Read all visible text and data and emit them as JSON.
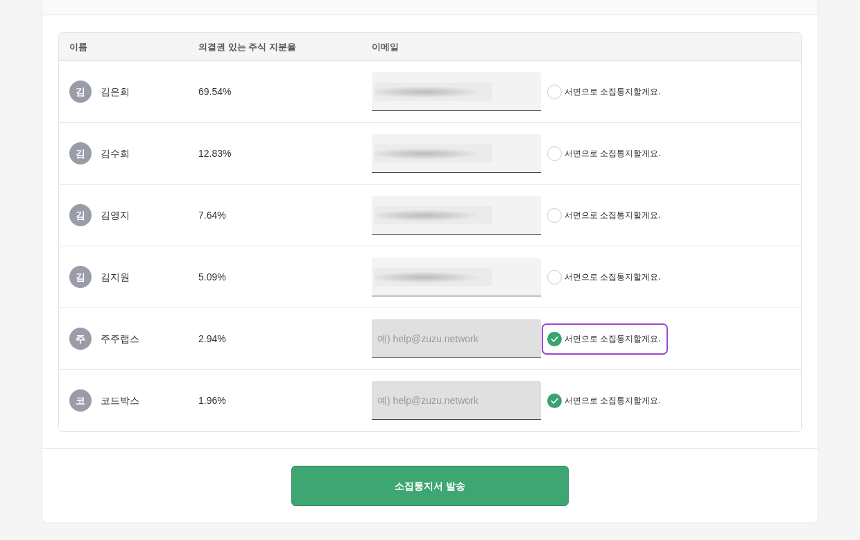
{
  "table": {
    "columns": [
      "이름",
      "의결권 있는 주식 지분율",
      "이메일"
    ],
    "rows": [
      {
        "initial": "김",
        "name": "김은희",
        "share": "69.54%",
        "email": {
          "blurred": true,
          "disabled": false
        },
        "notice": {
          "label": "서면으로 소집통지할게요.",
          "checked": false,
          "focused": false
        }
      },
      {
        "initial": "김",
        "name": "김수희",
        "share": "12.83%",
        "email": {
          "blurred": true,
          "disabled": false
        },
        "notice": {
          "label": "서면으로 소집통지할게요.",
          "checked": false,
          "focused": false
        }
      },
      {
        "initial": "김",
        "name": "김영지",
        "share": "7.64%",
        "email": {
          "blurred": true,
          "disabled": false
        },
        "notice": {
          "label": "서면으로 소집통지할게요.",
          "checked": false,
          "focused": false
        }
      },
      {
        "initial": "김",
        "name": "김지원",
        "share": "5.09%",
        "email": {
          "blurred": true,
          "disabled": false
        },
        "notice": {
          "label": "서면으로 소집통지할게요.",
          "checked": false,
          "focused": false
        }
      },
      {
        "initial": "주",
        "name": "주주랩스",
        "share": "2.94%",
        "email": {
          "placeholder": "예) help@zuzu.network",
          "disabled": true
        },
        "notice": {
          "label": "서면으로 소집통지할게요.",
          "checked": true,
          "focused": true
        }
      },
      {
        "initial": "코",
        "name": "코드박스",
        "share": "1.96%",
        "email": {
          "placeholder": "예) help@zuzu.network",
          "disabled": true
        },
        "notice": {
          "label": "서면으로 소집통지할게요.",
          "checked": true,
          "focused": false
        }
      }
    ]
  },
  "submit_button": "소집통지서 발송"
}
